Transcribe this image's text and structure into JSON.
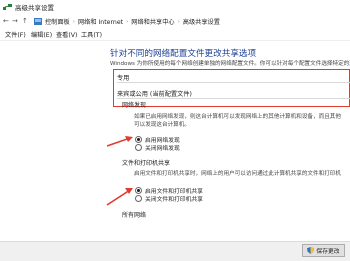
{
  "window": {
    "title": "高级共享设置"
  },
  "address": {
    "crumbs": [
      "控制面板",
      "网络和 Internet",
      "网络和共享中心",
      "高级共享设置"
    ]
  },
  "menu": {
    "items": [
      "文件(F)",
      "编辑(E)",
      "查看(V)",
      "工具(T)"
    ]
  },
  "main": {
    "heading": "针对不同的网络配置文件更改共享选项",
    "description": "Windows 为你所使用的每个网络创建单独的网络配置文件。你可以针对每个配置文件选择特定的选项",
    "profiles": {
      "private_label": "专用",
      "guest_label": "来宾或公用 (当前配置文件)"
    },
    "network_discovery": {
      "title": "网络发现",
      "text_line1": "如果已启用网络发现，则这台计算机可以发现网络上的其他计算机和设备，而且其他",
      "text_line2": "可以发现这台计算机。",
      "option_on": "启用网络发现",
      "option_off": "关闭网络发现",
      "selected": "on"
    },
    "file_printer_sharing": {
      "title": "文件和打印机共享",
      "text_line1": "启用文件和打印机共享时，网络上的用户可以访问通过此计算机共享的文件和打印机",
      "option_on": "启用文件和打印机共享",
      "option_off": "关闭文件和打印机共享",
      "selected": "on"
    },
    "all_networks_label": "所有网络"
  },
  "footer": {
    "save_label": "保存更改"
  },
  "colors": {
    "heading": "#1c3f94",
    "highlight_border": "#e23b2e",
    "arrow": "#e23b2e"
  }
}
